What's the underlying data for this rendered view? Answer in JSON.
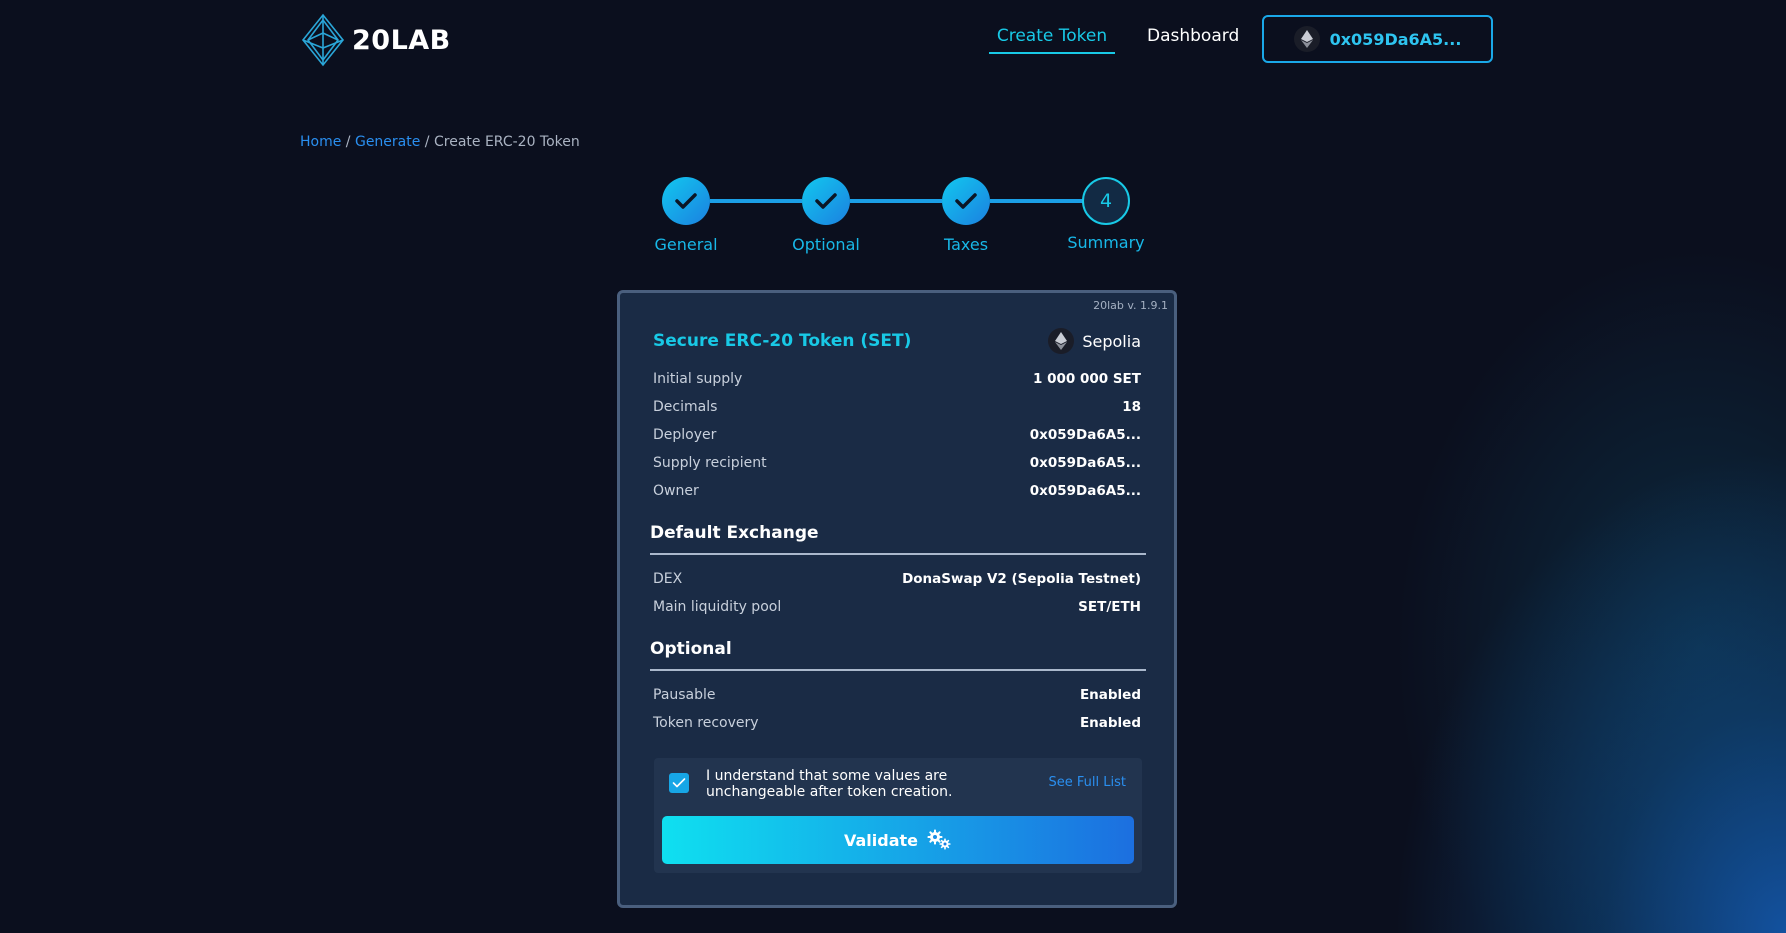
{
  "header": {
    "logo_text": "20LAB",
    "nav": {
      "create_token": "Create Token",
      "dashboard": "Dashboard"
    },
    "wallet_address": "0x059Da6A5..."
  },
  "breadcrumb": {
    "home": "Home",
    "sep1": " / ",
    "generate": "Generate",
    "sep2": " / ",
    "current": "Create ERC-20 Token"
  },
  "stepper": {
    "steps": [
      {
        "label": "General",
        "state": "done"
      },
      {
        "label": "Optional",
        "state": "done"
      },
      {
        "label": "Taxes",
        "state": "done"
      },
      {
        "label": "Summary",
        "state": "current",
        "number": "4"
      }
    ]
  },
  "card": {
    "version": "20lab v. 1.9.1",
    "title": "Secure ERC-20 Token (SET)",
    "network": "Sepolia",
    "rows": [
      {
        "label": "Initial supply",
        "value": "1 000 000 SET"
      },
      {
        "label": "Decimals",
        "value": "18"
      },
      {
        "label": "Deployer",
        "value": "0x059Da6A5..."
      },
      {
        "label": "Supply recipient",
        "value": "0x059Da6A5..."
      },
      {
        "label": "Owner",
        "value": "0x059Da6A5..."
      }
    ],
    "exchange": {
      "title": "Default Exchange",
      "rows": [
        {
          "label": "DEX",
          "value": "DonaSwap V2 (Sepolia Testnet)"
        },
        {
          "label": "Main liquidity pool",
          "value": "SET/ETH"
        }
      ]
    },
    "optional": {
      "title": "Optional",
      "rows": [
        {
          "label": "Pausable",
          "value": "Enabled"
        },
        {
          "label": "Token recovery",
          "value": "Enabled"
        }
      ]
    },
    "confirm": {
      "text": "I understand that some values are unchangeable after token creation.",
      "checked": true,
      "full_list_link": "See Full List"
    },
    "validate_label": "Validate"
  },
  "colors": {
    "accent": "#18c9e6",
    "link": "#2a8ff0",
    "background": "#0b0f1e",
    "card": "#1a2b45"
  }
}
